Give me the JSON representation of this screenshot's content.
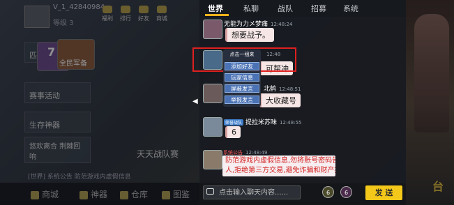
{
  "game": {
    "uid": "V_1_42840984",
    "level": "等级 3",
    "top_icons": [
      "福利",
      "排行",
      "好友",
      "商城"
    ],
    "modes": [
      "匹配",
      "全民军备",
      "赛事活动",
      "生存神器",
      "悠欢离合 荆棘回响"
    ],
    "card_badge": "7",
    "team_title": "天天战队赛",
    "ticker": "[世界] 系统公告 防范游戏内虚假信息",
    "bottom_nav": [
      "商城",
      "神器",
      "仓库",
      "图鉴"
    ],
    "side_word": "台"
  },
  "chat": {
    "tabs": [
      "世界",
      "私聊",
      "战队",
      "招募",
      "系统"
    ],
    "active_tab": "世界",
    "messages": [
      {
        "name": "无能为力メ梦痛",
        "time": "12:48:24",
        "text": "想要战予。"
      },
      {
        "name": "",
        "time": "12:48",
        "text": "可帮冲"
      },
      {
        "name": "北鹤",
        "time": "12:48:51",
        "text": "大收藏号"
      },
      {
        "name": "提拉米苏味",
        "vip": "荣誉战队",
        "time": "12:48:55",
        "text": "6"
      }
    ],
    "popup": {
      "header": "点击一组来",
      "buttons": [
        "添加好友",
        "玩家信息",
        "屏蔽发言",
        "举报发言"
      ]
    },
    "system": {
      "title": "系统公告",
      "time": "12:48:49",
      "line1": "防范游戏内虚假信息,勿将账号密码告知他",
      "line2": "人,拒绝第三方交易,避免诈骗和财产损失"
    },
    "input_placeholder": "点击输入聊天内容......",
    "bag_badges": [
      "6",
      "6"
    ],
    "send_label": "发 送"
  },
  "colors": {
    "accent": "#f4c81a",
    "highlight_box": "#e02020",
    "system_text": "#d42424"
  }
}
